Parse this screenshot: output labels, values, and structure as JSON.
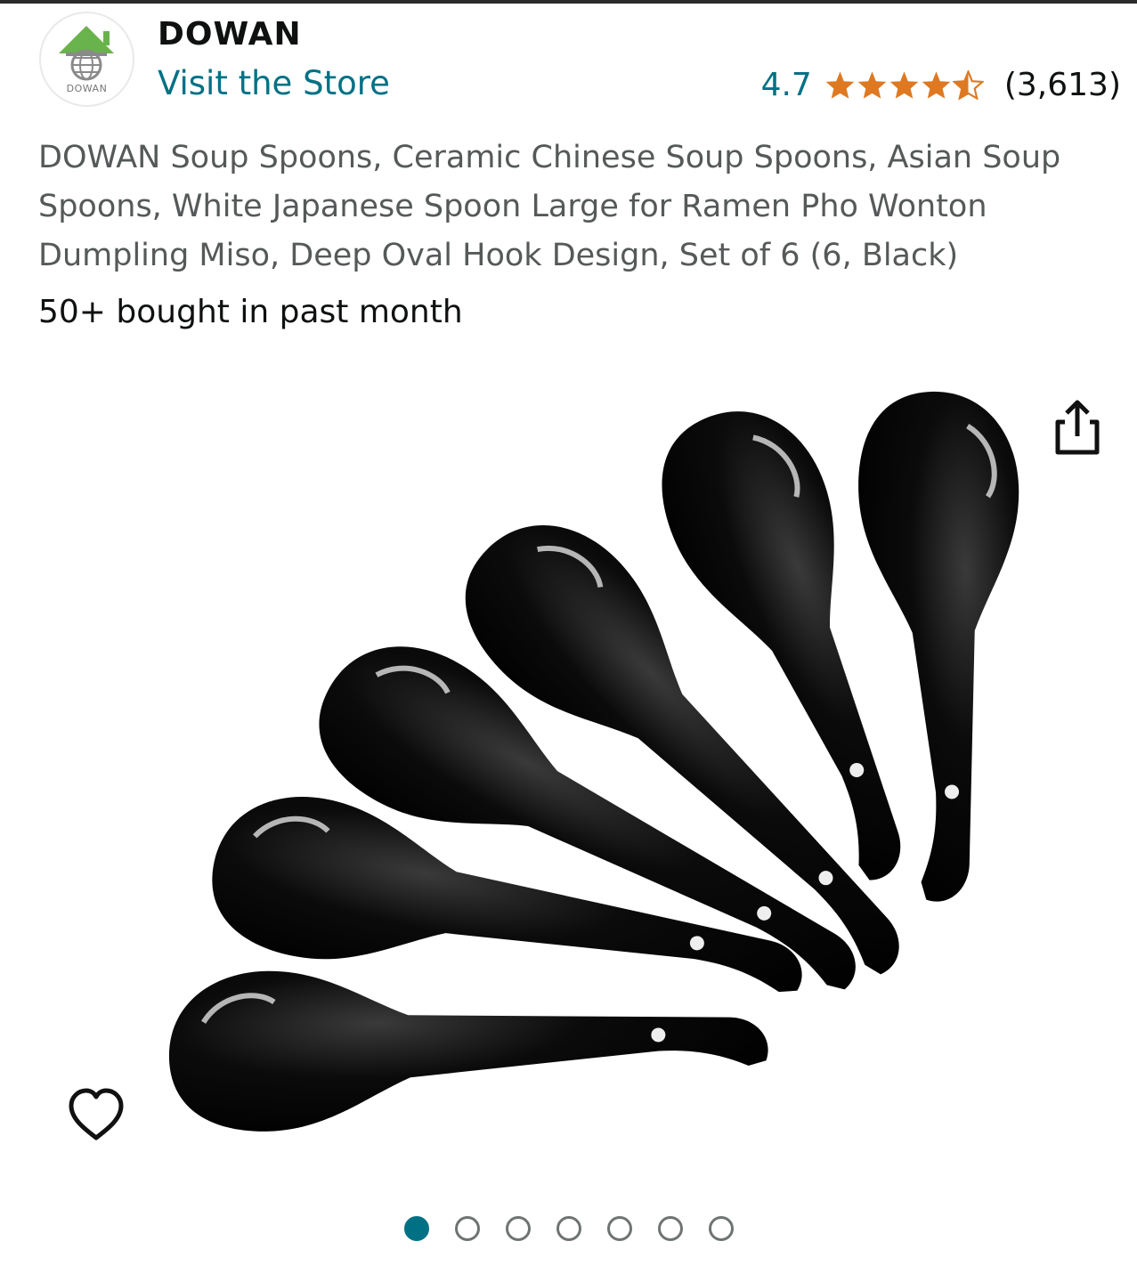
{
  "brand": {
    "name": "DOWAN",
    "logo_text": "DOWAN",
    "store_link": "Visit the Store"
  },
  "rating": {
    "value": "4.7",
    "stars": 4.5,
    "count": "(3,613)"
  },
  "product": {
    "title": "DOWAN Soup Spoons, Ceramic Chinese Soup Spoons, Asian Soup Spoons, White Japanese Spoon Large for Ramen Pho Wonton Dumpling Miso, Deep Oval Hook Design, Set of 6 (6, Black)",
    "bought_recently": "50+ bought in past month"
  },
  "gallery": {
    "image_count": 7,
    "active_index": 0
  },
  "icons": {
    "share": "share-icon",
    "favorite": "heart-icon",
    "logo": "house-globe-logo-icon"
  },
  "colors": {
    "link": "#007185",
    "star": "#de7921",
    "title": "#565959",
    "text": "#0f1111"
  }
}
